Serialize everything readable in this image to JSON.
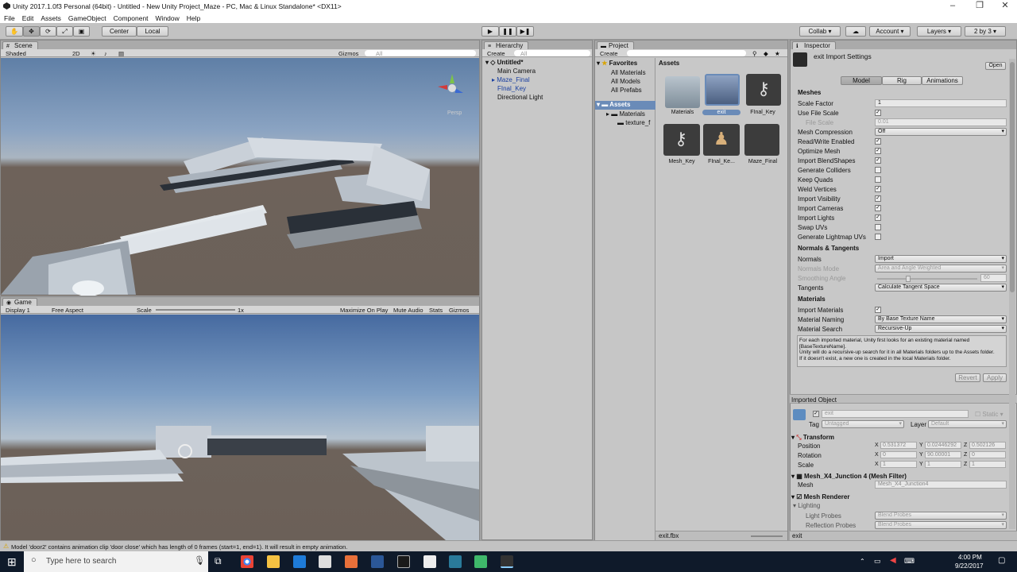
{
  "window": {
    "title": "Unity 2017.1.0f3 Personal (64bit) - Untitled - New Unity Project_Maze - PC, Mac & Linux Standalone* <DX11>"
  },
  "menu": [
    "File",
    "Edit",
    "Assets",
    "GameObject",
    "Component",
    "Window",
    "Help"
  ],
  "toolbar": {
    "center": "Center",
    "local": "Local",
    "collab": "Collab",
    "account": "Account",
    "layers": "Layers",
    "layout": "2 by 3"
  },
  "scene": {
    "tab": "Scene",
    "shading": "Shaded",
    "mode2d": "2D",
    "gizmos": "Gizmos",
    "search_placeholder": "All",
    "persp": "Persp"
  },
  "game": {
    "tab": "Game",
    "display": "Display 1",
    "aspect": "Free Aspect",
    "scale_label": "Scale",
    "scale_value": "1x",
    "maximize": "Maximize On Play",
    "mute": "Mute Audio",
    "stats": "Stats",
    "gizmos": "Gizmos"
  },
  "hierarchy": {
    "tab": "Hierarchy",
    "create": "Create",
    "search_placeholder": "All",
    "scene": "Untitled*",
    "items": [
      "Main Camera",
      "Maze_Final",
      "FInal_Key",
      "Directional Light"
    ]
  },
  "project": {
    "tab": "Project",
    "create": "Create",
    "favorites": "Favorites",
    "fav_items": [
      "All Materials",
      "All Models",
      "All Prefabs"
    ],
    "assets_root": "Assets",
    "tree": [
      "Materials",
      "texture_f"
    ],
    "assets_header": "Assets",
    "assets": [
      "Materials",
      "exit",
      "FInal_Key",
      "Mesh_Key",
      "FInal_Ke...",
      "Maze_Final"
    ],
    "footer_file": "exit.fbx"
  },
  "inspector": {
    "tab": "Inspector",
    "title": "exit Import Settings",
    "open": "Open",
    "tabs": [
      "Model",
      "Rig",
      "Animations"
    ],
    "meshes_header": "Meshes",
    "scale_factor_label": "Scale Factor",
    "scale_factor": "1",
    "use_file_scale": "Use File Scale",
    "file_scale_label": "File Scale",
    "file_scale": "0.01",
    "mesh_compression_label": "Mesh Compression",
    "mesh_compression": "Off",
    "checks": [
      "Read/Write Enabled",
      "Optimize Mesh",
      "Import BlendShapes",
      "Generate Colliders",
      "Keep Quads",
      "Weld Vertices",
      "Import Visibility",
      "Import Cameras",
      "Import Lights",
      "Swap UVs",
      "Generate Lightmap UVs"
    ],
    "checks_state": [
      true,
      true,
      true,
      false,
      false,
      true,
      true,
      true,
      true,
      false,
      false
    ],
    "normals_header": "Normals & Tangents",
    "normals_label": "Normals",
    "normals": "Import",
    "normals_mode_label": "Normals Mode",
    "normals_mode": "Area and Angle Weighted",
    "smoothing_label": "Smoothing Angle",
    "smoothing": "60",
    "tangents_label": "Tangents",
    "tangents": "Calculate Tangent Space",
    "materials_header": "Materials",
    "import_materials": "Import Materials",
    "material_naming_label": "Material Naming",
    "material_naming": "By Base Texture Name",
    "material_search_label": "Material Search",
    "material_search": "Recursive-Up",
    "help": "For each imported material, Unity first looks for an existing material named [BaseTextureName].\nUnity will do a recursive-up search for it in all Materials folders up to the Assets folder.\nIf it doesn't exist, a new one is created in the local Materials folder.",
    "revert": "Revert",
    "apply": "Apply",
    "imported_object": "Imported Object",
    "obj_name": "exit",
    "static": "Static",
    "tag_label": "Tag",
    "tag": "Untagged",
    "layer_label": "Layer",
    "layer": "Default",
    "transform": "Transform",
    "position_label": "Position",
    "position": [
      "0.531372",
      "0.02446292",
      "0.502126"
    ],
    "rotation_label": "Rotation",
    "rotation": [
      "0",
      "90.00001",
      "0"
    ],
    "scale_label": "Scale",
    "scale": [
      "1",
      "1",
      "1"
    ],
    "mesh_filter": "Mesh_X4_Junction 4 (Mesh Filter)",
    "mesh_label": "Mesh",
    "mesh": "Mesh_X4_Junction4",
    "mesh_renderer": "Mesh Renderer",
    "lighting": "Lighting",
    "light_probes_label": "Light Probes",
    "light_probes": "Blend Probes",
    "reflection_probes_label": "Reflection Probes",
    "reflection_probes": "Blend Probes",
    "footer": "exit"
  },
  "status": {
    "message": "Model 'door2' contains animation clip 'door close' which has length of 0 frames (start=1, end=1). It will result in empty animation."
  },
  "taskbar": {
    "search": "Type here to search",
    "time": "4:00 PM",
    "date": "9/22/2017"
  }
}
